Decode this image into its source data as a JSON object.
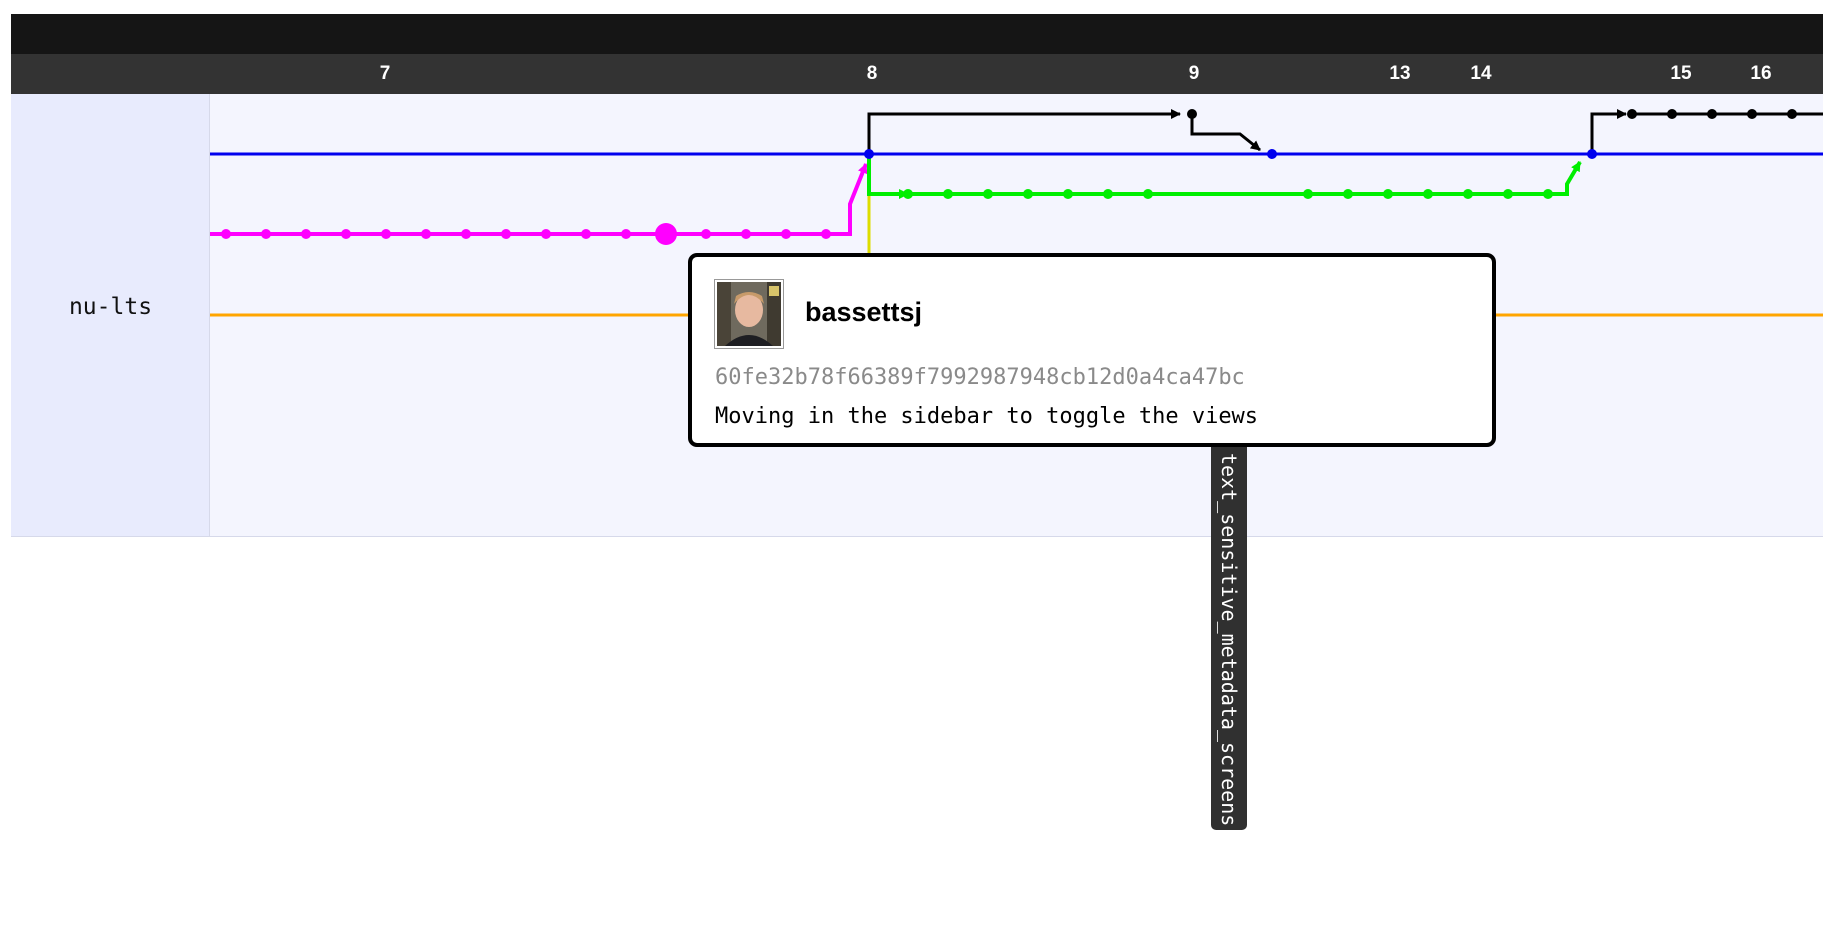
{
  "timeline": {
    "days": [
      "7",
      "8",
      "9",
      "13",
      "14",
      "15",
      "16"
    ]
  },
  "branch": {
    "name": "nu-lts"
  },
  "ref_label": {
    "text": "text_sensitive_metadata_screens"
  },
  "tooltip": {
    "author": "bassettsj",
    "sha": "60fe32b78f66389f7992987948cb12d0a4ca47bc",
    "message": "Moving in the sidebar to toggle the views",
    "avatar_icon": "user-avatar-photo"
  },
  "colors": {
    "header": "#151515",
    "date_bar": "#333333",
    "branch_panel": "#e8ebfd",
    "graph_background": "#f4f5fe",
    "lane_main": "#0000ee",
    "lane_feature": "#ff00ff",
    "lane_green": "#00ee00",
    "lane_orange": "#ffa500",
    "lane_black": "#000000",
    "lane_yellow": "#dddd00"
  }
}
